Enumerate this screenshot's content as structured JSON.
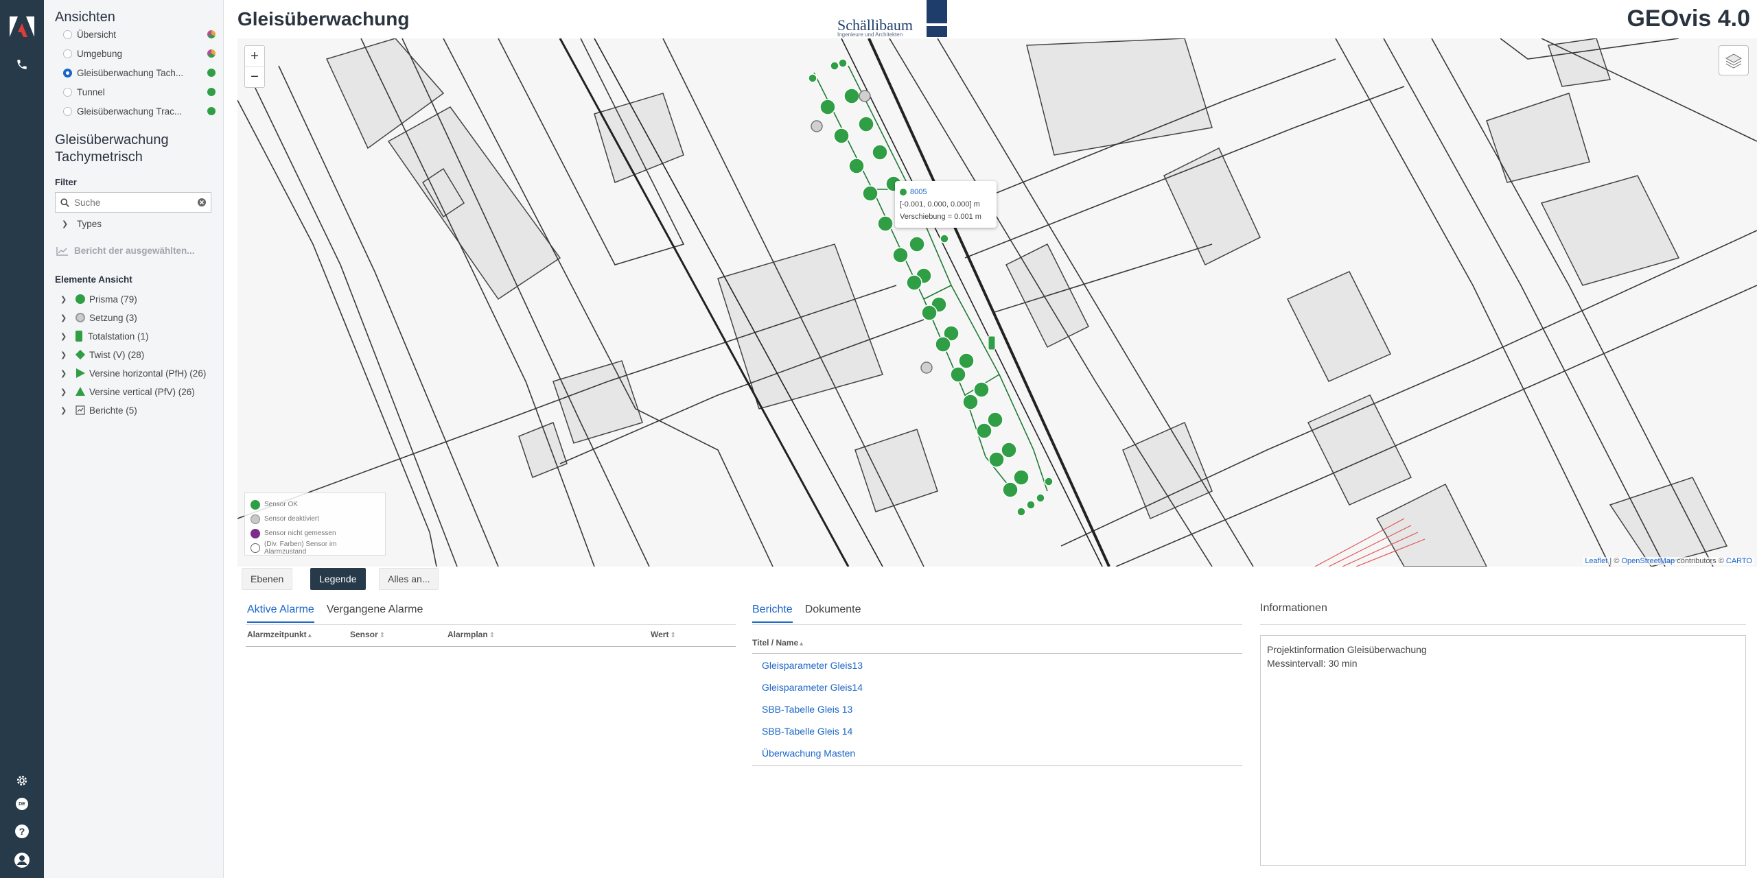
{
  "rail": {
    "icons": [
      "adobe-logo-icon",
      "phone-icon",
      "gear-icon",
      "language-icon",
      "help-icon",
      "user-icon"
    ],
    "language_code": "DE"
  },
  "sidebar": {
    "views_title": "Ansichten",
    "views": [
      {
        "label": "Übersicht",
        "status": "multi",
        "selected": false
      },
      {
        "label": "Umgebung",
        "status": "multi",
        "selected": false
      },
      {
        "label": "Gleisüberwachung Tach...",
        "status": "ok",
        "selected": true
      },
      {
        "label": "Tunnel",
        "status": "ok",
        "selected": false
      },
      {
        "label": "Gleisüberwachung Trac...",
        "status": "ok",
        "selected": false
      }
    ],
    "section_title_1": "Gleisüberwachung",
    "section_title_2": "Tachymetrisch",
    "filter_label": "Filter",
    "search_placeholder": "Suche",
    "types_label": "Types",
    "report_label": "Bericht der ausgewählten...",
    "elements_title": "Elemente Ansicht",
    "elements": [
      {
        "label": "Prisma (79)",
        "icon": "green-circle"
      },
      {
        "label": "Setzung (3)",
        "icon": "settlement-marker"
      },
      {
        "label": "Totalstation (1)",
        "icon": "total-station"
      },
      {
        "label": "Twist (V) (28)",
        "icon": "green-diamond"
      },
      {
        "label": "Versine horizontal (PfH) (26)",
        "icon": "green-triangle-right"
      },
      {
        "label": "Versine vertical (PfV) (26)",
        "icon": "green-triangle-up"
      },
      {
        "label": "Berichte (5)",
        "icon": "report"
      }
    ]
  },
  "header": {
    "title": "Gleisüberwachung",
    "brand_name": "Schällibaum",
    "brand_tagline": "Ingenieure und Architekten",
    "product": "GEOvis 4.0"
  },
  "map": {
    "zoom_in": "+",
    "zoom_out": "−",
    "popup": {
      "id": "8005",
      "vector": "[-0.001, 0.000, 0.000] m",
      "displacement": "Verschiebung = 0.001 m"
    },
    "legend": [
      {
        "label": "Sensor OK",
        "color": "#2f9e44"
      },
      {
        "label": "Sensor deaktiviert",
        "color": "#c8c8c8"
      },
      {
        "label": "Sensor nicht gemessen",
        "color": "#7b2d8e"
      },
      {
        "label": "(Div. Farben) Sensor im Alarmzustand",
        "color": "#ffffff"
      }
    ],
    "attribution_leaflet": "Leaflet",
    "attribution_sep": " | © ",
    "attribution_osm": "OpenStreetMap",
    "attribution_mid": " contributors © ",
    "attribution_carto": "CARTO"
  },
  "map_toolbar": {
    "layers": "Ebenen",
    "legend": "Legende",
    "all": "Alles an..."
  },
  "alarms": {
    "tab_active": "Aktive Alarme",
    "tab_past": "Vergangene Alarme",
    "columns": [
      "Alarmzeitpunkt",
      "Sensor",
      "Alarmplan",
      "Wert"
    ]
  },
  "reports": {
    "tab_reports": "Berichte",
    "tab_documents": "Dokumente",
    "column": "Titel / Name",
    "items": [
      "Gleisparameter Gleis13",
      "Gleisparameter Gleis14",
      "SBB-Tabelle Gleis 13",
      "SBB-Tabelle Gleis 14",
      "Überwachung Masten"
    ]
  },
  "info": {
    "title": "Informationen",
    "line1": "Projektinformation Gleisüberwachung",
    "line2": "Messintervall: 30 min"
  }
}
